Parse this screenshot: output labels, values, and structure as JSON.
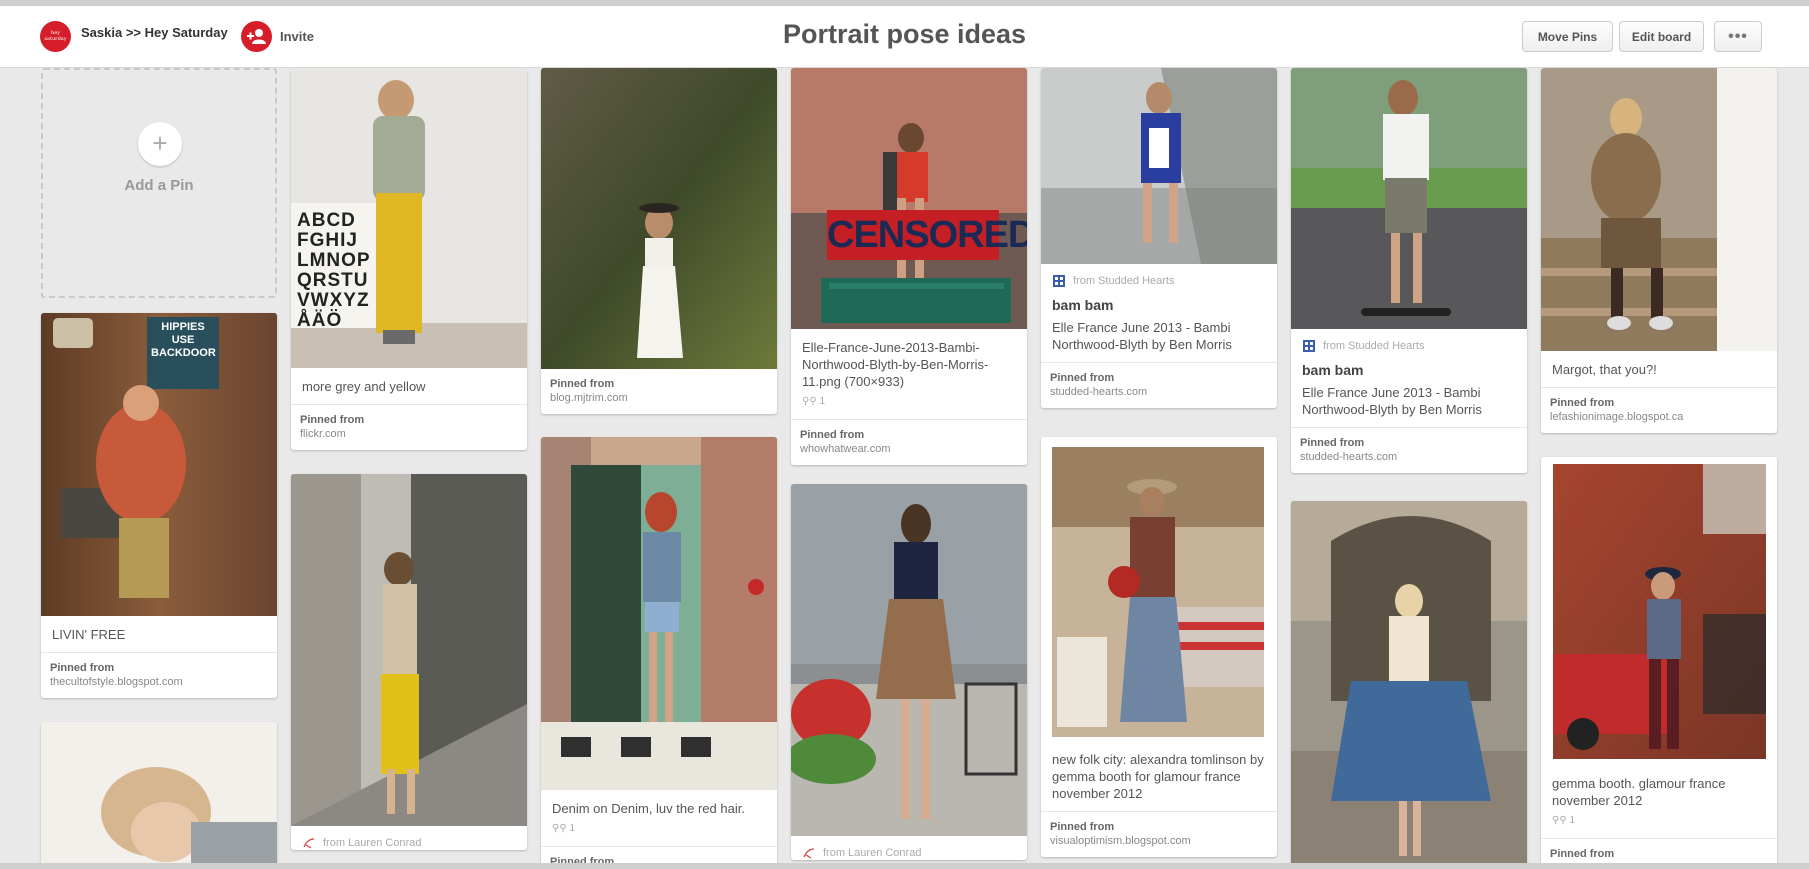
{
  "header": {
    "board_owner": "Saskia >> Hey Saturday",
    "avatar_text": "hey saturday",
    "invite_label": "Invite",
    "title": "Portrait pose ideas",
    "move_pins": "Move Pins",
    "edit_board": "Edit board",
    "more": "•••"
  },
  "add_pin": {
    "label": "Add a Pin",
    "icon": "plus-icon"
  },
  "pins": {
    "livin": {
      "desc": "LIVIN' FREE",
      "pinned_label": "Pinned from",
      "source": "thecultofstyle.blogspot.com"
    },
    "grey_yellow": {
      "desc": "more grey and yellow",
      "pinned_label": "Pinned from",
      "source": "flickr.com"
    },
    "white_dress": {
      "pinned_label": "Pinned from",
      "source": "blog.mjtrim.com"
    },
    "denim": {
      "desc": "Denim on Denim, luv the red hair.",
      "repins": "1",
      "pinned_label": "Pinned from"
    },
    "censored": {
      "desc": "Elle-France-June-2013-Bambi-Northwood-Blyth-by-Ben-Morris-11.png (700×933)",
      "repins": "1",
      "pinned_label": "Pinned from",
      "source": "whowhatwear.com"
    },
    "brown_skirt": {
      "via": "from Lauren Conrad"
    },
    "lauren_left": {
      "via": "from Lauren Conrad"
    },
    "bambam1": {
      "via": "from Studded Hearts",
      "title": "bam bam",
      "desc": "Elle France June 2013 - Bambi Northwood-Blyth by Ben Morris",
      "pinned_label": "Pinned from",
      "source": "studded-hearts.com"
    },
    "folk": {
      "desc": "new folk city: alexandra tomlinson by gemma booth for glamour france november 2012",
      "pinned_label": "Pinned from",
      "source": "visualoptimism.blogspot.com"
    },
    "bambam2": {
      "via": "from Studded Hearts",
      "title": "bam bam",
      "desc": "Elle France June 2013 - Bambi Northwood-Blyth by Ben Morris",
      "pinned_label": "Pinned from",
      "source": "studded-hearts.com"
    },
    "margot": {
      "desc": "Margot, that you?!",
      "pinned_label": "Pinned from",
      "source": "lefashionimage.blogspot.ca"
    },
    "gemma": {
      "desc": "gemma booth. glamour france november 2012",
      "repins": "1",
      "pinned_label": "Pinned from"
    }
  },
  "image_text": {
    "hippies_sign": "HIPPIES USE BACKDOOR",
    "censored_sign": "CENSORED",
    "alphabet": "ABCD FGHIJ LMNOP QRSTU VWXYZ ÅÄÖ"
  },
  "colors": {
    "brand_red": "#d61e2a",
    "background": "#e9e9e9"
  }
}
